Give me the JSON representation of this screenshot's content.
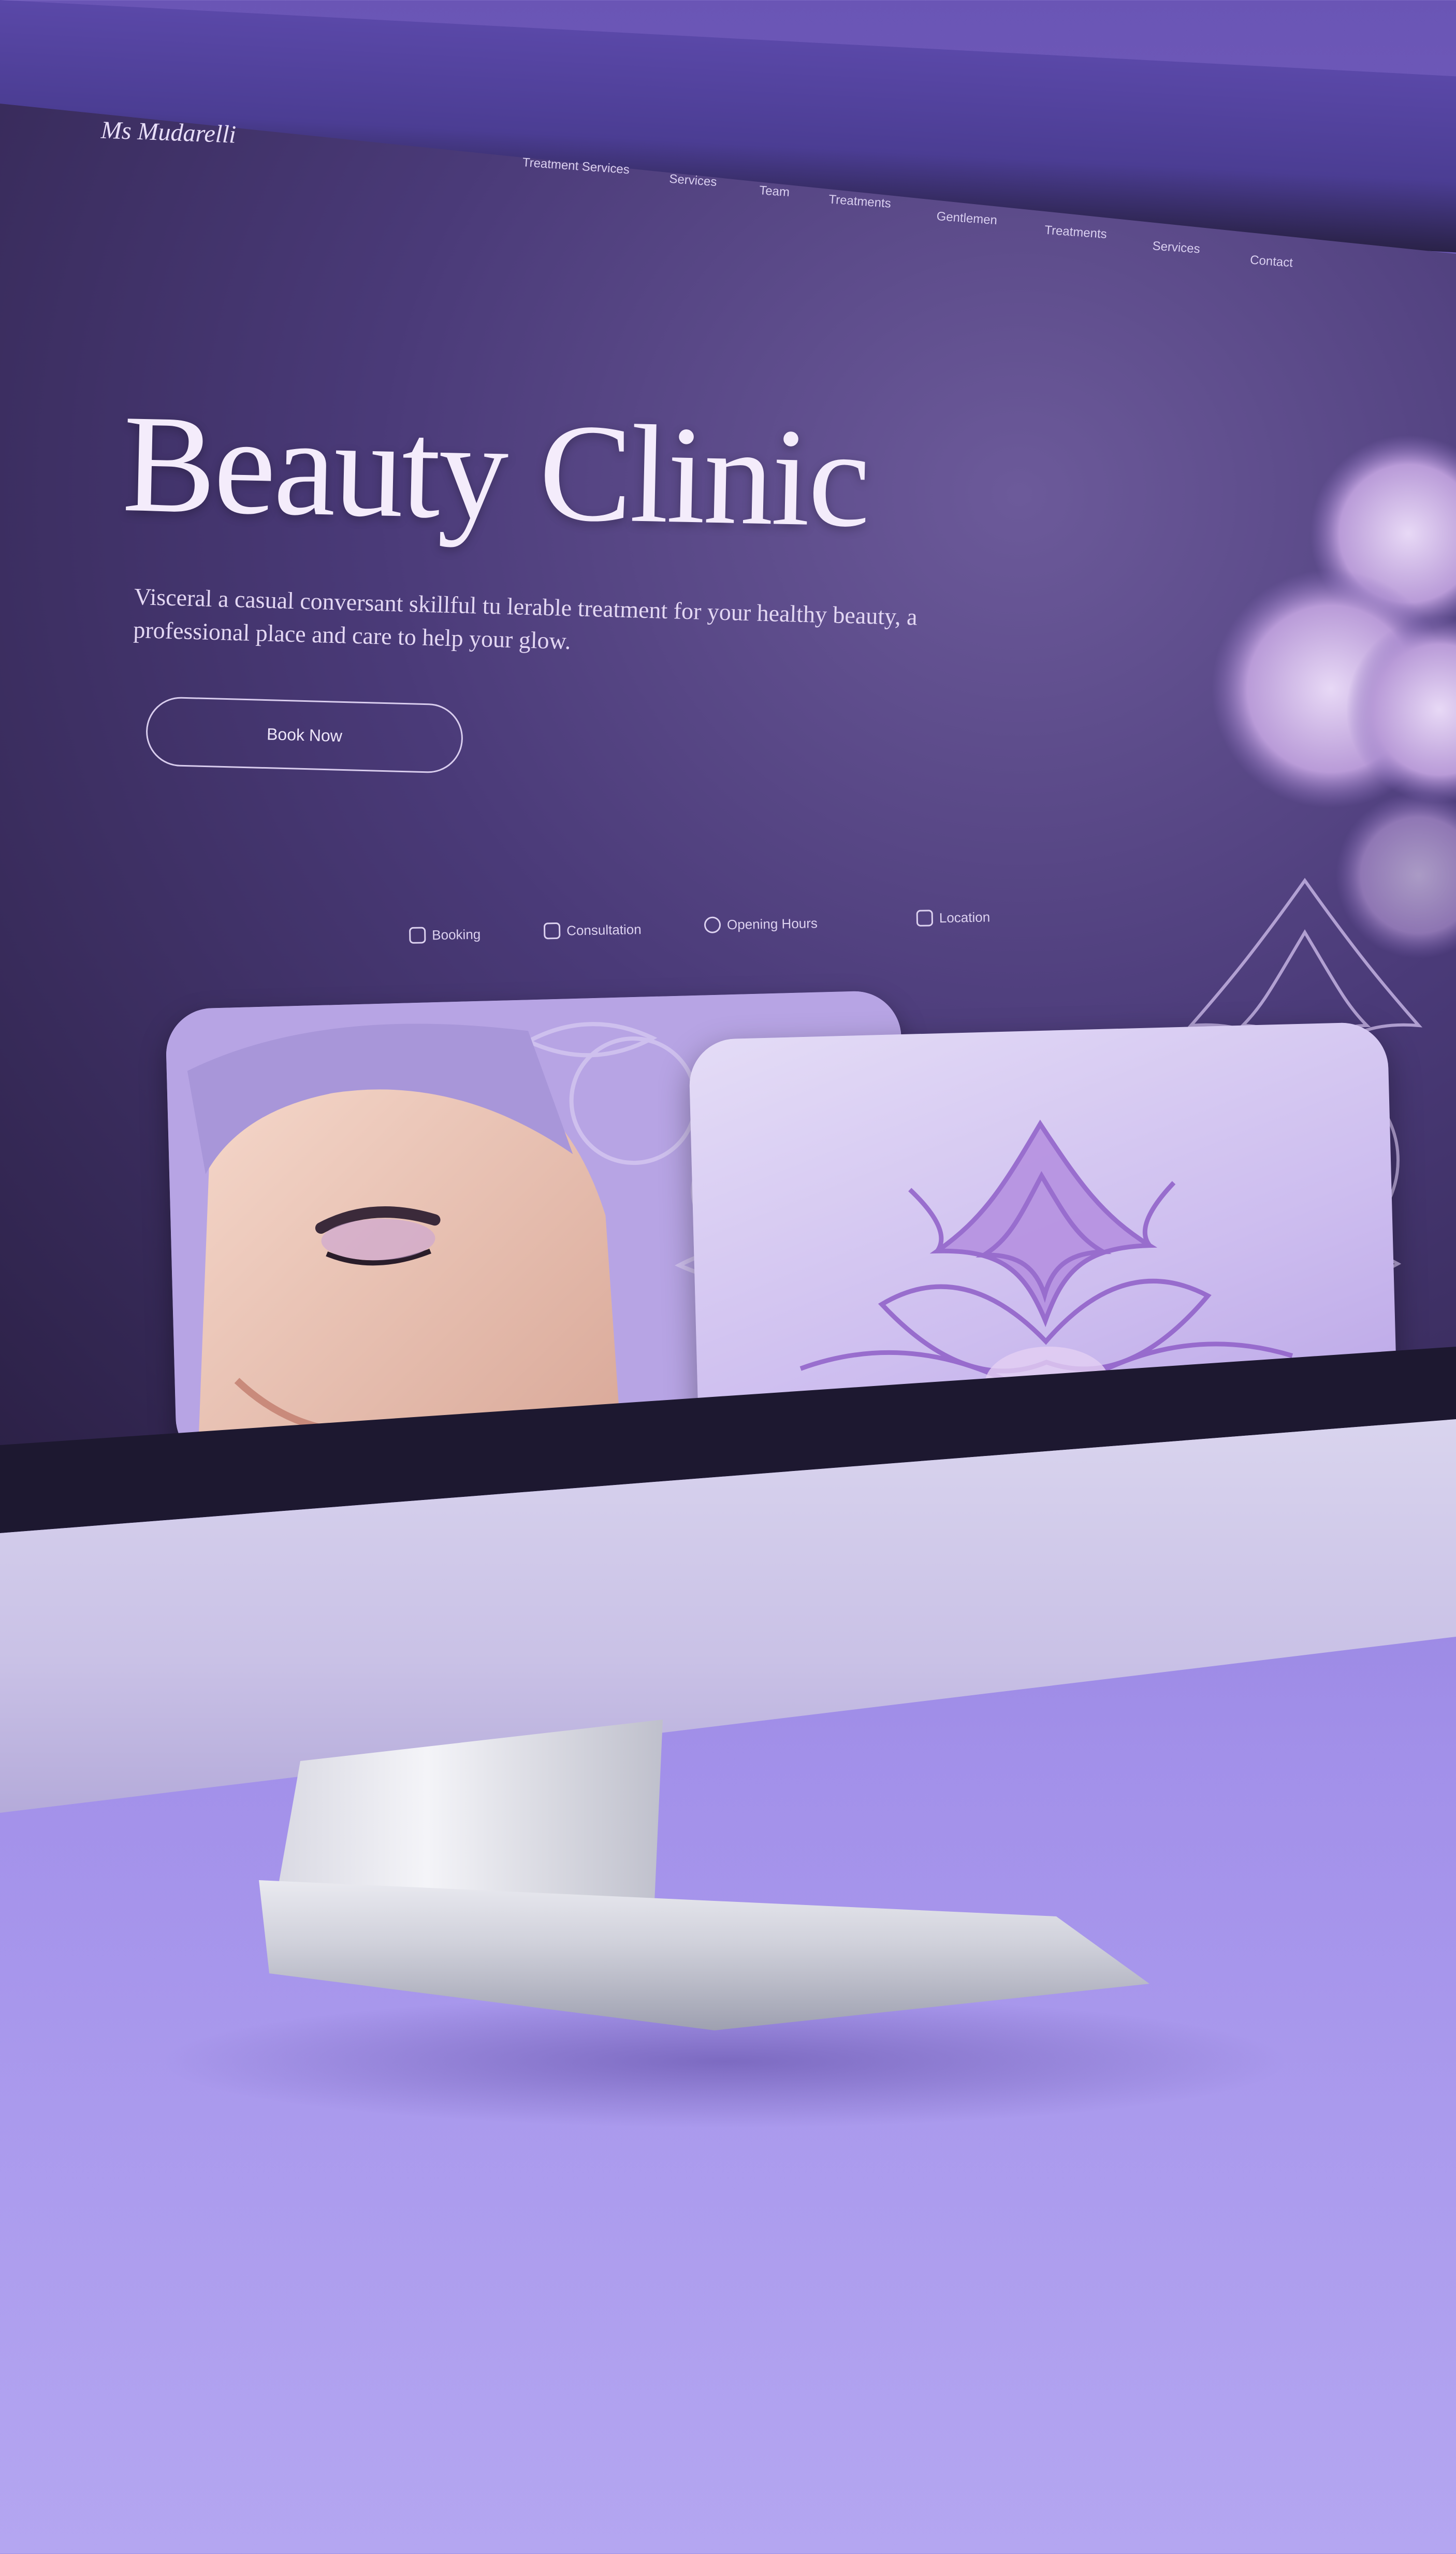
{
  "site": {
    "logo": "Ms Mudarelli",
    "nav": [
      "Treatment Services",
      "Services",
      "Team",
      "Treatments",
      "Gentlemen",
      "Treatments",
      "Services",
      "Contact"
    ],
    "hero_title": "Beauty Clinic",
    "hero_subtitle": "Visceral a casual conversant skillful tu lerable treatment for your healthy beauty, a professional place and care to help your glow.",
    "cta_label": "Book Now"
  },
  "info_bar": [
    {
      "icon": "phone-icon",
      "label": "Booking"
    },
    {
      "icon": "message-icon",
      "label": "Consultation"
    },
    {
      "icon": "clock-icon",
      "label": "Opening Hours"
    },
    {
      "icon": "location-icon",
      "label": "Location"
    }
  ],
  "colors": {
    "accent": "#6a55b5",
    "screen_dark": "#2c2147",
    "text_light": "#f4ecfb",
    "card_lavender": "#cdbdef"
  }
}
